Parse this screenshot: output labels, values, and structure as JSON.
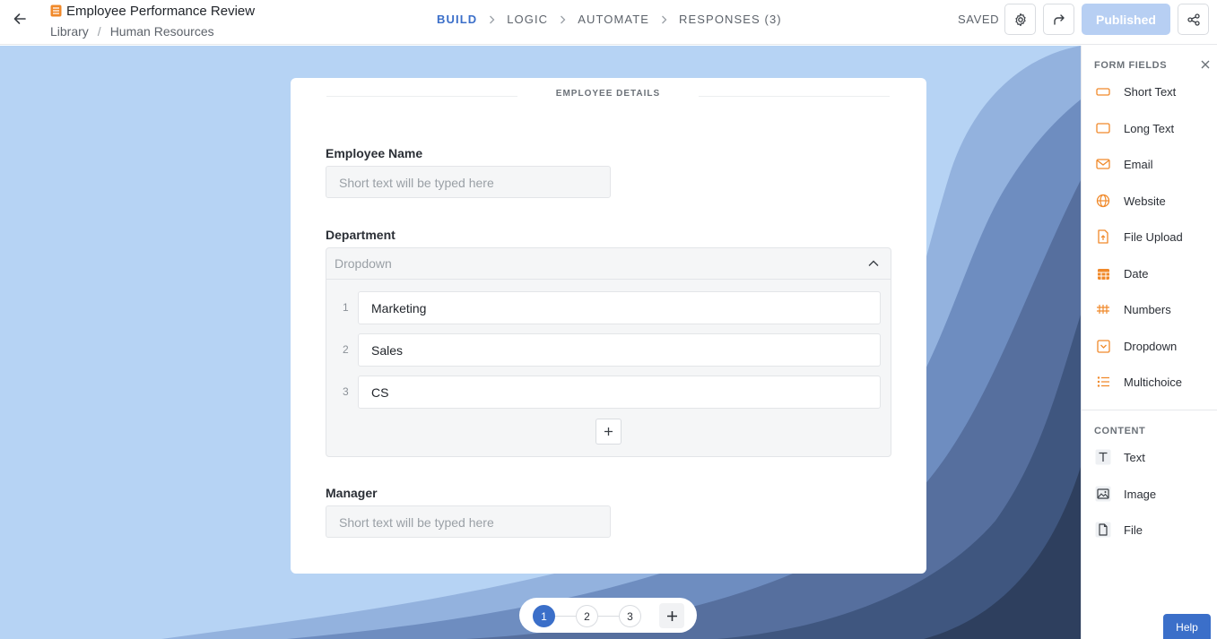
{
  "header": {
    "form_title": "Employee Performance Review",
    "breadcrumb": [
      "Library",
      "Human Resources"
    ],
    "steps": [
      {
        "label": "BUILD",
        "active": true
      },
      {
        "label": "LOGIC",
        "active": false
      },
      {
        "label": "AUTOMATE",
        "active": false
      },
      {
        "label": "RESPONSES (3)",
        "active": false
      }
    ],
    "saved_label": "SAVED",
    "publish_label": "Published"
  },
  "form": {
    "section_title": "EMPLOYEE DETAILS",
    "fields": {
      "employee_name": {
        "label": "Employee Name",
        "placeholder": "Short text will be typed here"
      },
      "department": {
        "label": "Department",
        "placeholder": "Dropdown",
        "options": [
          "Marketing",
          "Sales",
          "CS"
        ]
      },
      "manager": {
        "label": "Manager",
        "placeholder": "Short text will be typed here"
      }
    }
  },
  "pagination": {
    "pages": [
      "1",
      "2",
      "3"
    ],
    "current": "1"
  },
  "sidebar": {
    "form_fields_heading": "FORM FIELDS",
    "form_fields": [
      {
        "label": "Short Text",
        "icon": "short-text-icon"
      },
      {
        "label": "Long Text",
        "icon": "long-text-icon"
      },
      {
        "label": "Email",
        "icon": "email-icon"
      },
      {
        "label": "Website",
        "icon": "globe-icon"
      },
      {
        "label": "File Upload",
        "icon": "file-upload-icon"
      },
      {
        "label": "Date",
        "icon": "calendar-icon"
      },
      {
        "label": "Numbers",
        "icon": "numbers-icon"
      },
      {
        "label": "Dropdown",
        "icon": "dropdown-icon"
      },
      {
        "label": "Multichoice",
        "icon": "list-icon"
      }
    ],
    "content_heading": "CONTENT",
    "content_items": [
      {
        "label": "Text",
        "icon": "text-icon"
      },
      {
        "label": "Image",
        "icon": "image-icon"
      },
      {
        "label": "File",
        "icon": "file-icon"
      }
    ],
    "help_label": "Help"
  },
  "colors": {
    "accent": "#3b6fc9",
    "field_icon": "#f0892a",
    "publish_disabled": "#b7cff3",
    "canvas_light": "#b6d3f4"
  }
}
